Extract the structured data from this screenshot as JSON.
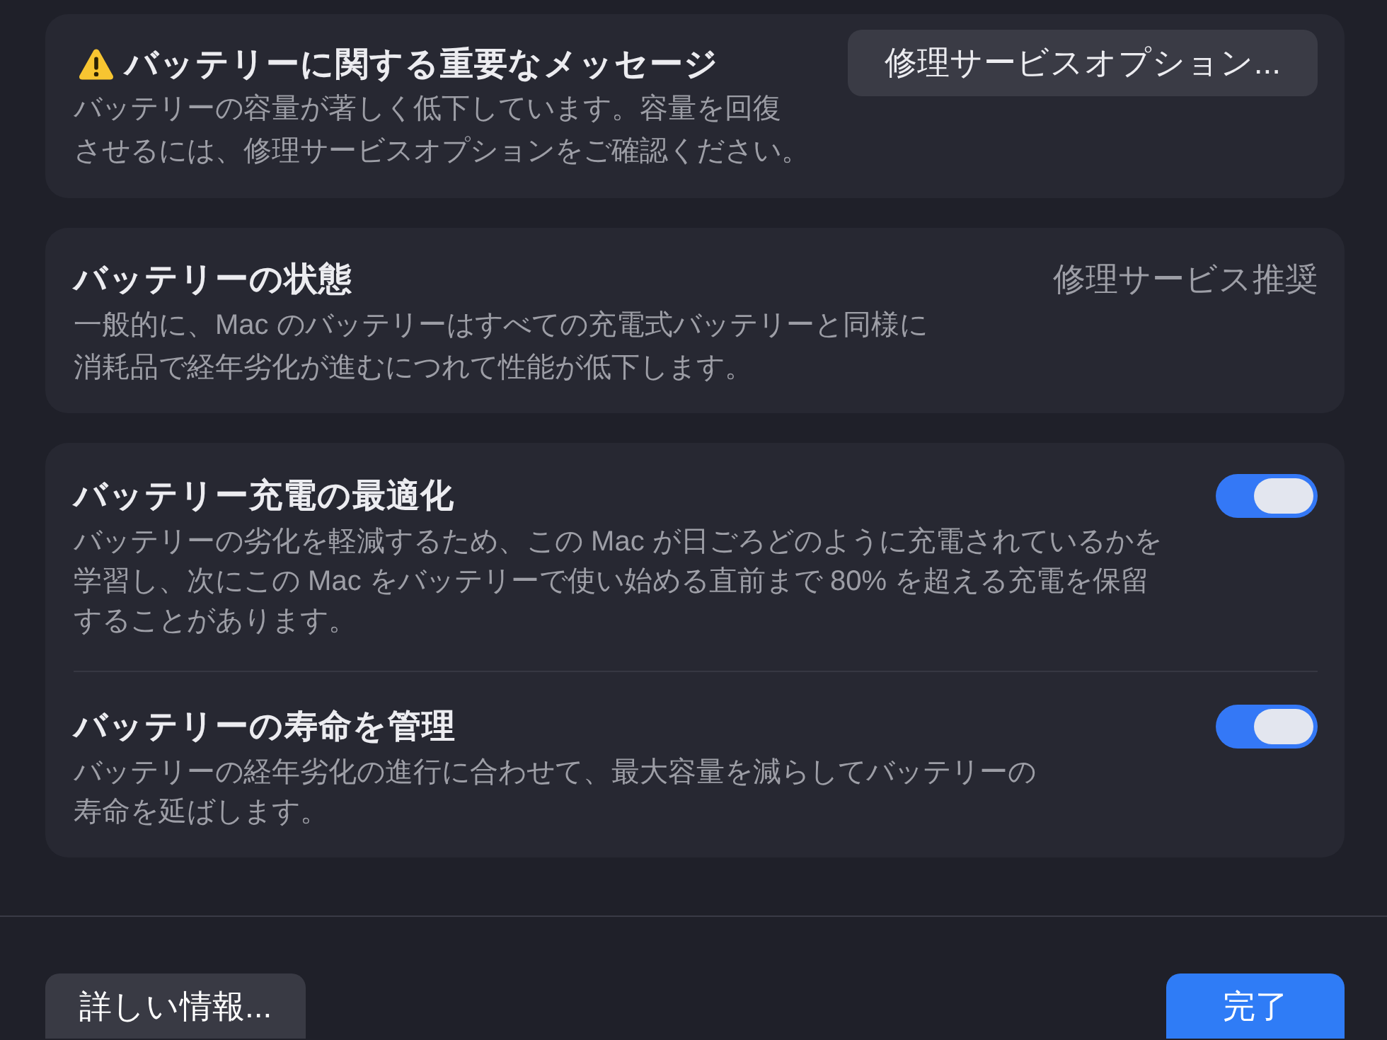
{
  "alert": {
    "title": "バッテリーに関する重要なメッセージ",
    "description": "バッテリーの容量が著しく低下しています。容量を回復させるには、修理サービスオプションをご確認ください。",
    "button": "修理サービスオプション..."
  },
  "health": {
    "title": "バッテリーの状態",
    "status": "修理サービス推奨",
    "description": "一般的に、Mac のバッテリーはすべての充電式バッテリーと同様に消耗品で経年劣化が進むにつれて性能が低下します。"
  },
  "settings": [
    {
      "title": "バッテリー充電の最適化",
      "description": "バッテリーの劣化を軽減するため、この Mac が日ごろどのように充電されているかを学習し、次にこの Mac をバッテリーで使い始める直前まで 80% を超える充電を保留することがあります。",
      "on": true
    },
    {
      "title": "バッテリーの寿命を管理",
      "description": "バッテリーの経年劣化の進行に合わせて、最大容量を減らしてバッテリーの寿命を延ばします。",
      "on": true
    }
  ],
  "footer": {
    "buttons": [
      {
        "label": "詳しい情報...",
        "kind": "secondary"
      },
      {
        "label": "完了",
        "kind": "primary"
      }
    ]
  }
}
